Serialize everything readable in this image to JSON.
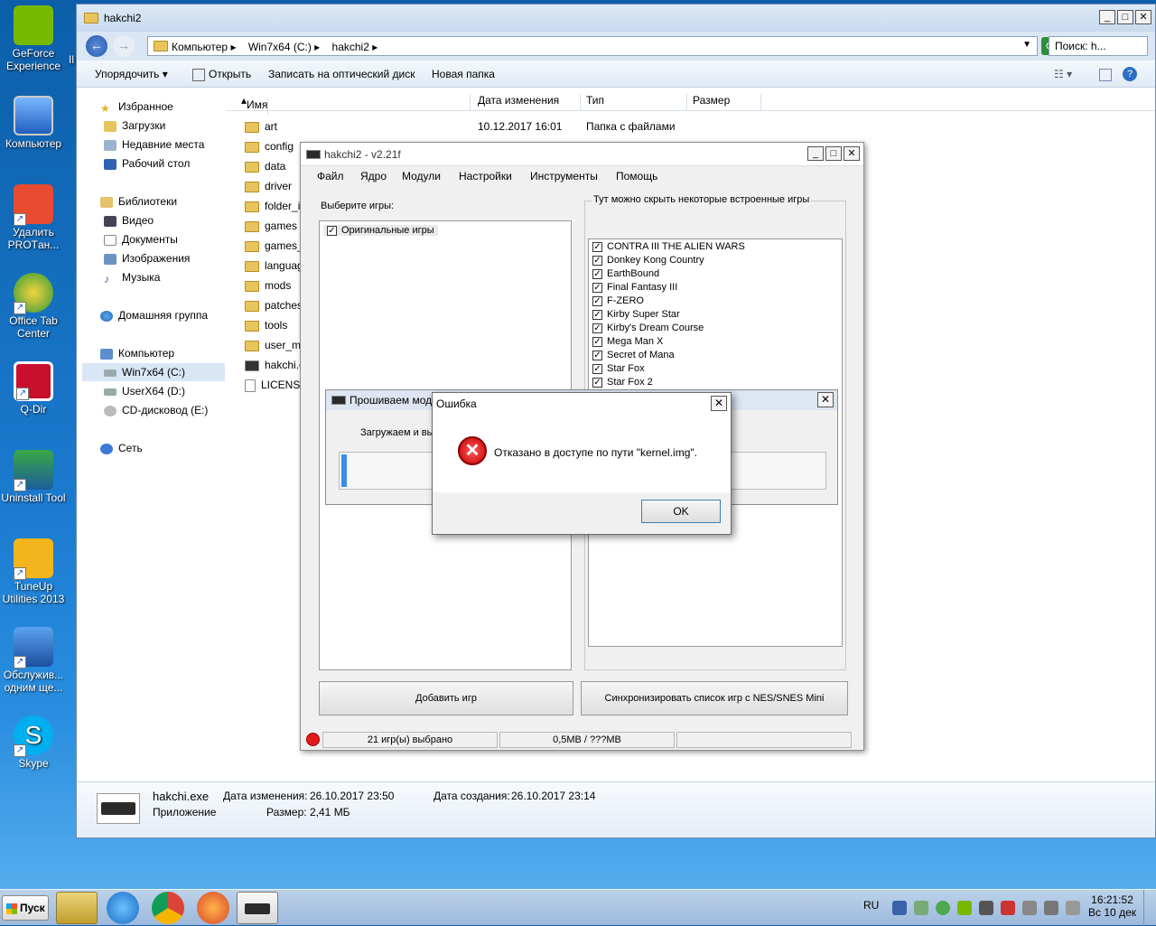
{
  "desktop": {
    "icons": [
      {
        "label": "GeForce Experience"
      },
      {
        "label": "Компьютер"
      },
      {
        "label": "Удалить PROTан..."
      },
      {
        "label": "Office Tab Center"
      },
      {
        "label": "Q-Dir"
      },
      {
        "label": "Uninstall Tool"
      },
      {
        "label": "TuneUp Utilities 2013"
      },
      {
        "label": "Обслужив... одним ще..."
      },
      {
        "label": "Skype"
      }
    ],
    "partial_label": "Il"
  },
  "explorer": {
    "title": "hakchi2",
    "breadcrumbs": [
      "Компьютер ▸",
      "Win7x64 (C:) ▸",
      "hakchi2 ▸"
    ],
    "search_placeholder": "Поиск: h...",
    "toolbar": {
      "organize": "Упорядочить ▾",
      "open": "Открыть",
      "burn": "Записать на оптический диск",
      "new_folder": "Новая папка"
    },
    "nav": {
      "favorites": "Избранное",
      "downloads": "Загрузки",
      "recent": "Недавние места",
      "desktop": "Рабочий стол",
      "libraries": "Библиотеки",
      "video": "Видео",
      "documents": "Документы",
      "images": "Изображения",
      "music": "Музыка",
      "homegroup": "Домашняя группа",
      "computer": "Компьютер",
      "drive_c": "Win7x64 (C:)",
      "drive_d": "UserX64 (D:)",
      "drive_e": "CD-дисковод (E:)",
      "network": "Сеть"
    },
    "columns": {
      "name": "Имя",
      "date": "Дата изменения",
      "type": "Тип",
      "size": "Размер"
    },
    "first_row": {
      "name": "art",
      "date": "10.12.2017 16:01",
      "type": "Папка с файлами"
    },
    "files": [
      "config",
      "data",
      "driver",
      "folder_ir",
      "games",
      "games_s",
      "languag",
      "mods",
      "patches",
      "tools",
      "user_mc",
      "hakchi.e",
      "LICENSE"
    ],
    "details": {
      "name": "hakchi.exe",
      "kind": "Приложение",
      "modified_label": "Дата изменения:",
      "modified": "26.10.2017 23:50",
      "created_label": "Дата создания:",
      "created": "26.10.2017 23:14",
      "size_label": "Размер:",
      "size": "2,41 МБ"
    }
  },
  "hakchi": {
    "title": "hakchi2 - v2.21f",
    "menu": [
      "Файл",
      "Ядро",
      "Модули",
      "Настройки",
      "Инструменты",
      "Помощь"
    ],
    "select_games_label": "Выберите игры:",
    "original_games": "Оригинальные игры",
    "hide_label": "Тут можно скрыть некоторые встроенные игры",
    "builtin_games": [
      "CONTRA III THE ALIEN WARS",
      "Donkey Kong Country",
      "EarthBound",
      "Final Fantasy III",
      "F-ZERO",
      "Kirby Super Star",
      "Kirby's Dream Course",
      "Mega Man X",
      "Secret of Mana",
      "Star Fox",
      "Star Fox 2"
    ],
    "add_games": "Добавить игр",
    "sync": "Синхронизировать список игр с NES/SNES Mini",
    "status": {
      "selected": "21 игр(ы) выбрано",
      "size": "0,5MB / ???MB"
    }
  },
  "flash": {
    "title": "Прошиваем мод",
    "text": "Загружаем и вы"
  },
  "error": {
    "title": "Ошибка",
    "message": "Отказано в доступе по пути \"kernel.img\".",
    "ok": "OK"
  },
  "taskbar": {
    "start": "Пуск",
    "lang": "RU",
    "time": "16:21:52",
    "date": "Вс 10 дек"
  }
}
